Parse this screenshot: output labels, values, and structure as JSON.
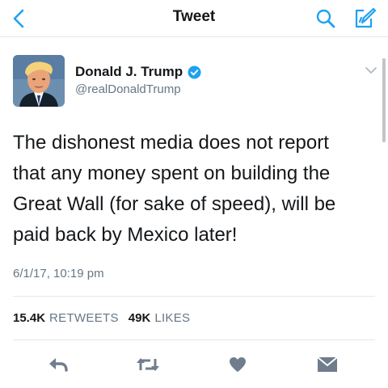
{
  "header": {
    "title": "Tweet",
    "back_icon": "chevron-left-icon",
    "search_icon": "search-icon",
    "compose_icon": "compose-tweet-icon"
  },
  "tweet": {
    "display_name": "Donald J. Trump",
    "handle": "@realDonaldTrump",
    "verified": true,
    "text": "The dishonest media does not report\nthat any money spent on building the\nGreat Wall (for sake of speed), will be\npaid back by Mexico later!",
    "timestamp": "6/1/17, 10:19 pm",
    "retweet_count": "15.4K",
    "retweet_label": "RETWEETS",
    "like_count": "49K",
    "like_label": "LIKES"
  },
  "actions": [
    {
      "name": "reply",
      "icon": "reply-icon"
    },
    {
      "name": "retweet",
      "icon": "retweet-icon"
    },
    {
      "name": "like",
      "icon": "heart-icon"
    },
    {
      "name": "direct-message",
      "icon": "envelope-icon"
    }
  ],
  "colors": {
    "accent": "#1da1f2",
    "text": "#14171a",
    "secondary_text": "#657786",
    "divider": "#e1e8ed",
    "action_icon": "#6f7d8c"
  }
}
